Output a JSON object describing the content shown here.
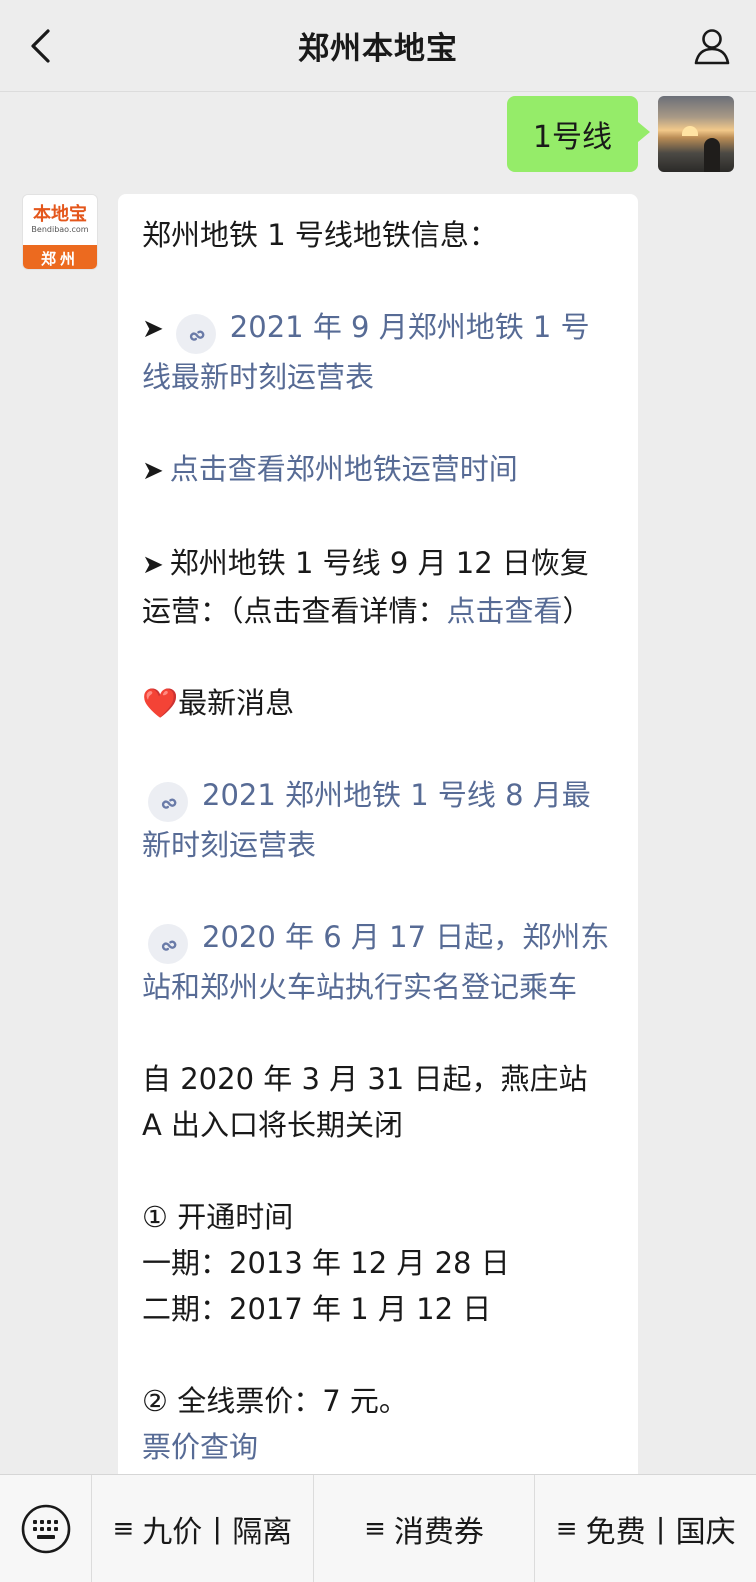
{
  "header": {
    "title": "郑州本地宝"
  },
  "user_message": {
    "text": "1号线"
  },
  "bot_avatar": {
    "brand": "本地宝",
    "domain": "Bendibao.com",
    "city": "郑州"
  },
  "reply": {
    "intro": "郑州地铁 1 号线地铁信息：",
    "arrow": "➤",
    "link1": "2021 年 9 月郑州地铁 1 号线最新时刻运营表",
    "link2": "点击查看郑州地铁运营时间",
    "resume_text": "郑州地铁 1 号线 9 月 12 日恢复运营：（点击查看详情：",
    "resume_link": "点击查看",
    "resume_close": "）",
    "heart": "❤️",
    "latest_title": "最新消息",
    "link3": "2021 郑州地铁 1 号线 8 月最新时刻运营表",
    "link4": "2020 年 6 月 17 日起，郑州东站和郑州火车站执行实名登记乘车",
    "notice": "自 2020 年 3 月 31 日起，燕庄站 A 出入口将长期关闭",
    "open_title": "① 开通时间",
    "phase1": "一期：2013 年 12 月 28 日",
    "phase2": "二期：2017 年 1 月 12 日",
    "fare": "② 全线票价：7 元。",
    "fare_link": "票价查询"
  },
  "bottom_menu": [
    {
      "prefix": "≡",
      "label": "九价丨隔离"
    },
    {
      "prefix": "≡",
      "label": "消费券"
    },
    {
      "prefix": "≡",
      "label": "免费丨国庆"
    }
  ],
  "colors": {
    "link": "#576b95",
    "user_bubble": "#95ec69",
    "brand_orange": "#ec6a1f"
  }
}
